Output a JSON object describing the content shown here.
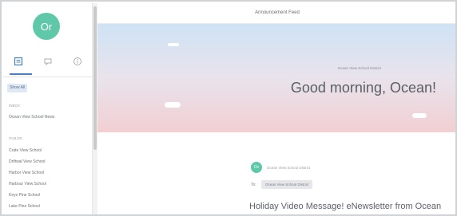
{
  "sidebar": {
    "avatar_initials": "Or",
    "show_all_label": "Show All",
    "section_1_label": "INBOX",
    "section_1_items": [
      "Ocean View School News"
    ],
    "section_2_label": "GUILDS",
    "section_2_items": [
      "Crate View School",
      "Driftwal View School",
      "Harbor View School",
      "Harbour View School",
      "Keys Pine School",
      "Lake Pine School"
    ]
  },
  "header": {
    "title": "Announcement Feed"
  },
  "hero": {
    "subtitle": "Ocean View School District",
    "greeting": "Good morning, Ocean!"
  },
  "post": {
    "avatar_initials": "Ov",
    "author": "Ocean View School District",
    "to_label": "To:",
    "to_chip": "Ocean View School District",
    "title": "Holiday Video Message! eNewsletter from Ocean"
  },
  "colors": {
    "avatar": "#5ec8a8",
    "accent": "#4a7fbf",
    "hero_top": "#cfe3f5",
    "hero_bottom": "#f1cfd2"
  }
}
